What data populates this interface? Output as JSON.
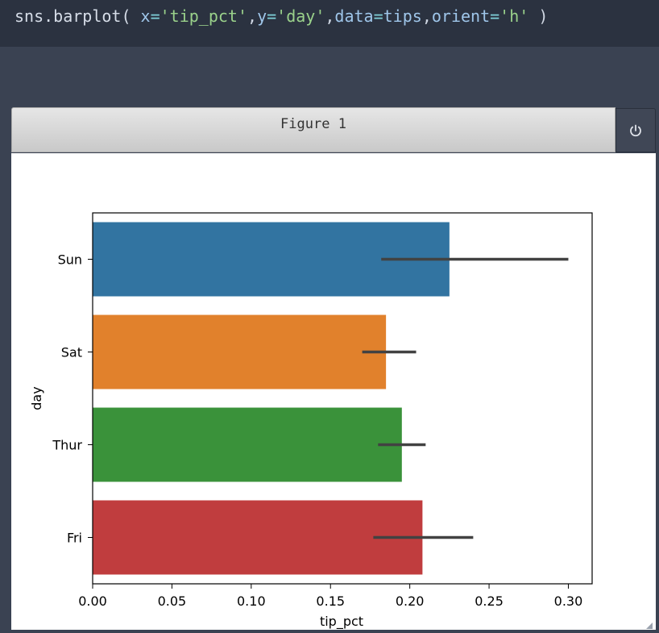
{
  "code": {
    "fn": "sns.barplot(",
    "arg1_key": "x",
    "arg1_val": "'tip_pct'",
    "arg2_key": "y",
    "arg2_val": "'day'",
    "arg3_key": "data",
    "arg3_val": "tips",
    "arg4_key": "orient",
    "arg4_val": "'h'",
    "close": ")"
  },
  "figure": {
    "title": "Figure 1"
  },
  "chart_data": {
    "type": "bar",
    "orientation": "horizontal",
    "categories": [
      "Sun",
      "Sat",
      "Thur",
      "Fri"
    ],
    "values": [
      0.225,
      0.185,
      0.195,
      0.208
    ],
    "error_low": [
      0.182,
      0.17,
      0.18,
      0.177
    ],
    "error_high": [
      0.3,
      0.204,
      0.21,
      0.24
    ],
    "colors": [
      "#3274a1",
      "#e1812c",
      "#3a923a",
      "#c03d3e"
    ],
    "error_color": "#424242",
    "xlabel": "tip_pct",
    "ylabel": "day",
    "xlim": [
      0.0,
      0.315
    ],
    "xticks": [
      0.0,
      0.05,
      0.1,
      0.15,
      0.2,
      0.25,
      0.3
    ],
    "xtick_labels": [
      "0.00",
      "0.05",
      "0.10",
      "0.15",
      "0.20",
      "0.25",
      "0.30"
    ],
    "grid": false
  }
}
